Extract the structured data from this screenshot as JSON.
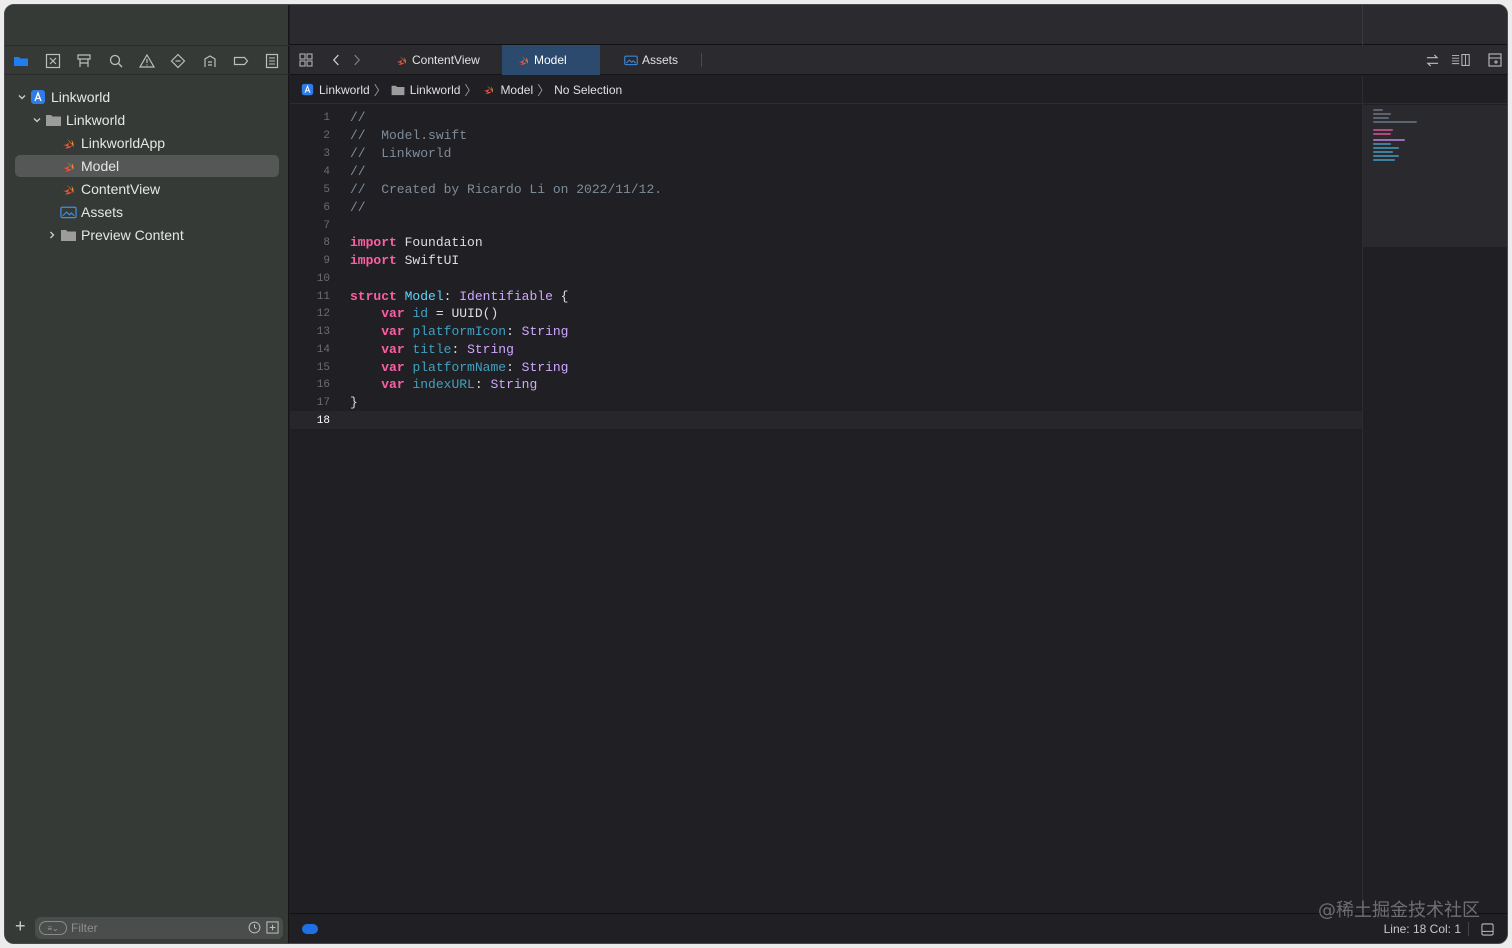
{
  "sidebar": {
    "tree": [
      {
        "label": "Linkworld",
        "type": "project",
        "expanded": true
      },
      {
        "label": "Linkworld",
        "type": "folder",
        "expanded": true
      },
      {
        "label": "LinkworldApp",
        "type": "swift-file"
      },
      {
        "label": "Model",
        "type": "swift-file",
        "selected": true
      },
      {
        "label": "ContentView",
        "type": "swift-file"
      },
      {
        "label": "Assets",
        "type": "asset-catalog"
      },
      {
        "label": "Preview Content",
        "type": "folder",
        "expanded": false
      }
    ],
    "filter": {
      "placeholder": "Filter"
    }
  },
  "tabs": [
    {
      "label": "ContentView",
      "icon": "swift-icon"
    },
    {
      "label": "Model",
      "icon": "swift-icon",
      "active": true
    },
    {
      "label": "Assets",
      "icon": "assets-icon"
    }
  ],
  "breadcrumb": {
    "project": "Linkworld",
    "folder": "Linkworld",
    "file": "Model",
    "symbol": "No Selection"
  },
  "code": {
    "line_numbers": [
      "1",
      "2",
      "3",
      "4",
      "5",
      "6",
      "7",
      "8",
      "9",
      "10",
      "11",
      "12",
      "13",
      "14",
      "15",
      "16",
      "17",
      "18"
    ],
    "current_line": "18",
    "lines": {
      "l1": "//",
      "l2": "//  Model.swift",
      "l3": "//  Linkworld",
      "l4": "//",
      "l5": "//  Created by Ricardo Li on 2022/11/12.",
      "l6": "//",
      "l8_kw": "import",
      "l8_rest": " Foundation",
      "l9_kw": "import",
      "l9_rest": " SwiftUI",
      "l11_kw": "struct",
      "l11_name": "Model",
      "l11_colon": ": ",
      "l11_type": "Identifiable",
      "l11_brace": " {",
      "l12_kw": "var",
      "l12_name": "id",
      "l12_rest": " = UUID()",
      "l13_kw": "var",
      "l13_name": "platformIcon",
      "l13_colon": ": ",
      "l13_type": "String",
      "l14_kw": "var",
      "l14_name": "title",
      "l14_colon": ": ",
      "l14_type": "String",
      "l15_kw": "var",
      "l15_name": "platformName",
      "l15_colon": ": ",
      "l15_type": "String",
      "l16_kw": "var",
      "l16_name": "indexURL",
      "l16_colon": ": ",
      "l16_type": "String",
      "l17": "}"
    }
  },
  "status": {
    "position": "Line: 18  Col: 1"
  },
  "watermark": "@稀土掘金技术社区",
  "colors": {
    "keyword": "#fc5fa3",
    "type_decl": "#5dd8ff",
    "type_ref": "#d0a8ff",
    "property": "#41a1c0",
    "comment": "#7f8c98",
    "accent": "#1f6fe5",
    "swift": "#f05138"
  }
}
